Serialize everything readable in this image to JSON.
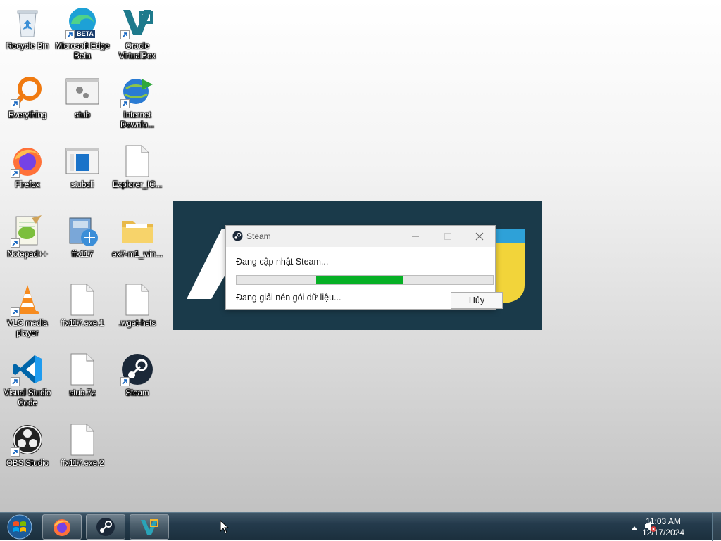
{
  "desktop": {
    "icons": [
      {
        "label": "Recycle Bin"
      },
      {
        "label": "Microsoft Edge Beta",
        "badge": "BETA"
      },
      {
        "label": "Oracle VirtualBox"
      },
      {
        "label": "Everything"
      },
      {
        "label": "stub"
      },
      {
        "label": "Internet Downlo..."
      },
      {
        "label": "Firefox"
      },
      {
        "label": "stubcli"
      },
      {
        "label": "Explorer_IC..."
      },
      {
        "label": "Notepad++"
      },
      {
        "label": "ffx117"
      },
      {
        "label": "ex7-m1_win..."
      },
      {
        "label": "VLC media player"
      },
      {
        "label": "ffx117.exe.1"
      },
      {
        "label": ".wget-hsts"
      },
      {
        "label": "Visual Studio Code"
      },
      {
        "label": "stub.7z"
      },
      {
        "label": "Steam"
      },
      {
        "label": "OBS Studio"
      },
      {
        "label": "ffx117.exe.2"
      }
    ]
  },
  "dialog": {
    "title": "Steam",
    "status": "Đang cập nhật Steam...",
    "substatus": "Đang giải nén gói dữ liệu...",
    "cancel_label": "Hủy",
    "progress": {
      "start": 0.31,
      "end": 0.65
    }
  },
  "taskbar": {
    "items": [
      "start-orb",
      "firefox",
      "steam",
      "virtualbox"
    ],
    "time": "11:03 AM",
    "date": "12/17/2024"
  },
  "colors": {
    "progress_fill": "#06b025",
    "splash_bg": "#1a3a4a",
    "accent_yellow": "#f2d43a",
    "accent_blue": "#2ea1d8"
  }
}
